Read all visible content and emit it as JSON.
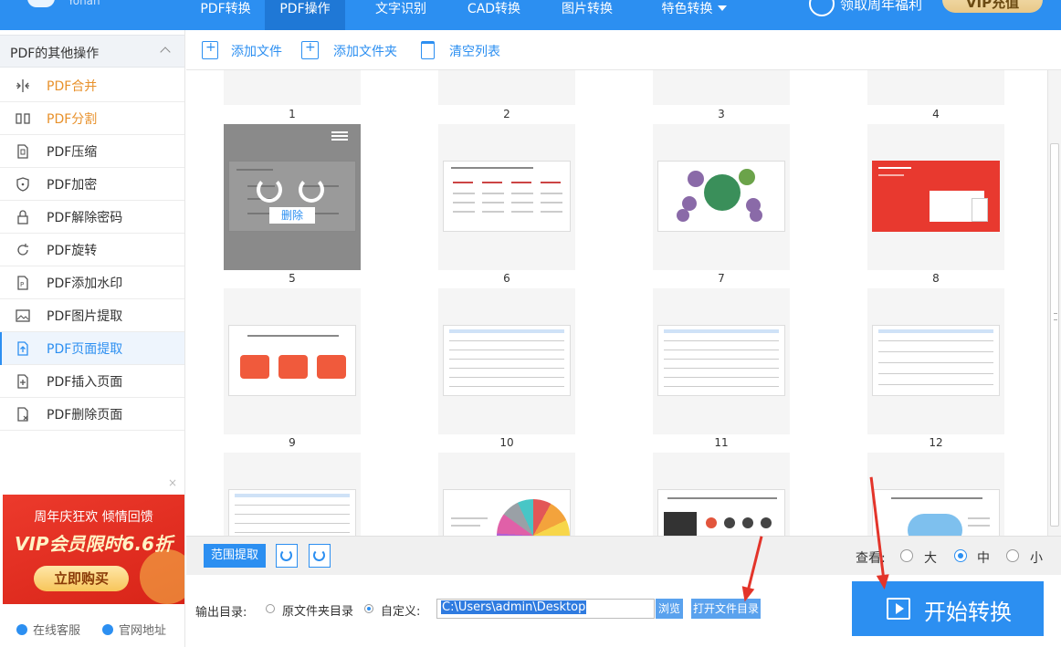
{
  "app": {
    "logo_text": "Yohan"
  },
  "nav": {
    "tabs": [
      {
        "label": "PDF转换"
      },
      {
        "label": "PDF操作"
      },
      {
        "label": "文字识别"
      },
      {
        "label": "CAD转换"
      },
      {
        "label": "图片转换"
      },
      {
        "label": "特色转换"
      }
    ],
    "active_tab": "PDF操作",
    "promo_text": "领取周年福利",
    "vip_label": "VIP充值"
  },
  "sidebar": {
    "header": "PDF的其他操作",
    "items": [
      {
        "label": "PDF合并",
        "icon": "merge-icon"
      },
      {
        "label": "PDF分割",
        "icon": "split-icon"
      },
      {
        "label": "PDF压缩",
        "icon": "compress-icon"
      },
      {
        "label": "PDF加密",
        "icon": "shield-icon"
      },
      {
        "label": "PDF解除密码",
        "icon": "lock-icon"
      },
      {
        "label": "PDF旋转",
        "icon": "rotate-icon"
      },
      {
        "label": "PDF添加水印",
        "icon": "watermark-icon"
      },
      {
        "label": "PDF图片提取",
        "icon": "image-icon"
      },
      {
        "label": "PDF页面提取",
        "icon": "extract-page-icon"
      },
      {
        "label": "PDF插入页面",
        "icon": "insert-page-icon"
      },
      {
        "label": "PDF删除页面",
        "icon": "delete-page-icon"
      }
    ],
    "active_item": "PDF页面提取",
    "ad": {
      "line1": "周年庆狂欢 倾情回馈",
      "line2": "VIP会员限时6.6折",
      "button": "立即购买",
      "close": "×"
    },
    "footer": {
      "support": "在线客服",
      "website": "官网地址"
    }
  },
  "toolbar": {
    "add_file": "添加文件",
    "add_folder": "添加文件夹",
    "clear_list": "清空列表"
  },
  "pages": {
    "numbers": [
      "1",
      "2",
      "3",
      "4",
      "5",
      "6",
      "7",
      "8",
      "9",
      "10",
      "11",
      "12"
    ],
    "selected_page": "5",
    "delete_label": "删除"
  },
  "bottom": {
    "range_extract": "范围提取",
    "view_label": "查看:",
    "view_options": [
      "大",
      "中",
      "小"
    ],
    "view_selected": "中",
    "output_label": "输出目录:",
    "opt_original": "原文件夹目录",
    "opt_custom": "自定义:",
    "output_selected": "自定义",
    "path": "C:\\Users\\admin\\Desktop",
    "browse": "浏览",
    "open_dir": "打开文件目录",
    "start": "开始转换"
  },
  "colors": {
    "accent": "#2c8ff1",
    "orange": "#e8912b",
    "arrow": "#e3342a"
  }
}
